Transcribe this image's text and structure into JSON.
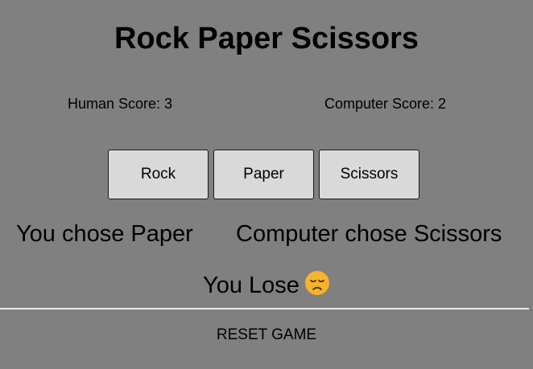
{
  "title": "Rock Paper Scissors",
  "scores": {
    "human_label": "Human Score: 3",
    "computer_label": "Computer Score: 2"
  },
  "choices": [
    {
      "label": "Rock"
    },
    {
      "label": "Paper"
    },
    {
      "label": "Scissors"
    }
  ],
  "result": {
    "you_chose": "You chose Paper",
    "computer_chose": "Computer chose Scissors",
    "outcome": "You Lose",
    "outcome_icon": "disappointed-face-icon"
  },
  "reset_label": "RESET GAME",
  "colors": {
    "background": "#808080",
    "button_bg": "#d9d9d9",
    "divider": "#e8e8e8",
    "emoji": "#f7b32b"
  }
}
